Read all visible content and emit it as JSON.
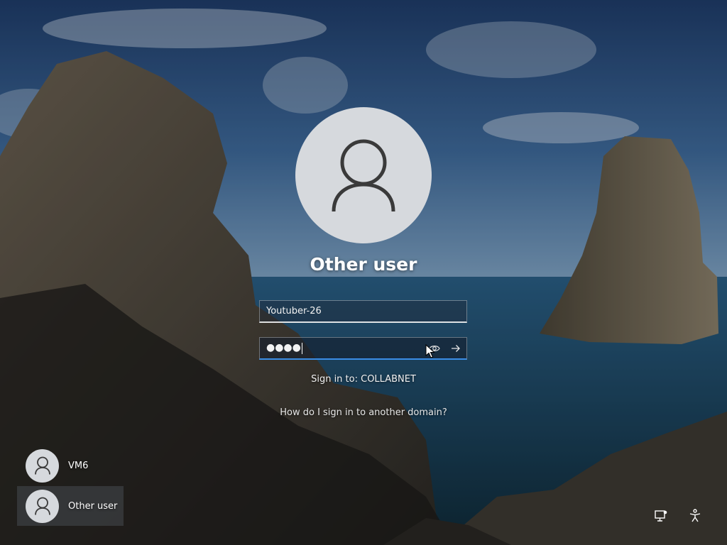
{
  "login": {
    "display_name": "Other user",
    "username_value": "Youtuber-26",
    "password_mask": "●●●●",
    "sign_in_to": "Sign in to: COLLABNET",
    "domain_help_link": "How do I sign in to another domain?"
  },
  "users": [
    {
      "label": "VM6"
    },
    {
      "label": "Other user"
    }
  ],
  "icons": {
    "avatar": "user-icon",
    "reveal": "eye-icon",
    "submit": "arrow-right-icon",
    "network": "network-icon",
    "accessibility": "accessibility-icon"
  },
  "colors": {
    "avatar_bg": "#d6d9dd",
    "focus_underline": "#3a8ee6"
  }
}
